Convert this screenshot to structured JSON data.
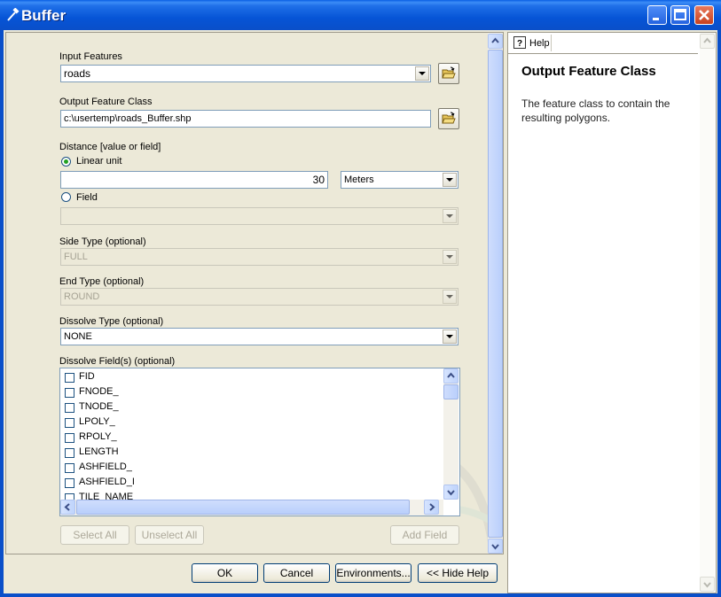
{
  "window": {
    "title": "Buffer"
  },
  "form": {
    "input_features": {
      "label": "Input Features",
      "value": "roads"
    },
    "output_feature_class": {
      "label": "Output Feature Class",
      "value": "c:\\usertemp\\roads_Buffer.shp"
    },
    "distance": {
      "label": "Distance [value or field]",
      "linear_unit_label": "Linear unit",
      "linear_unit_selected": true,
      "value": "30",
      "unit": "Meters",
      "field_label": "Field",
      "field_value": ""
    },
    "side_type": {
      "label": "Side Type (optional)",
      "value": "FULL"
    },
    "end_type": {
      "label": "End Type (optional)",
      "value": "ROUND"
    },
    "dissolve_type": {
      "label": "Dissolve Type (optional)",
      "value": "NONE"
    },
    "dissolve_fields": {
      "label": "Dissolve Field(s) (optional)",
      "items": [
        "FID",
        "FNODE_",
        "TNODE_",
        "LPOLY_",
        "RPOLY_",
        "LENGTH",
        "ASHFIELD_",
        "ASHFIELD_I",
        "TILE_NAME"
      ]
    },
    "select_all_label": "Select All",
    "unselect_all_label": "Unselect All",
    "add_field_label": "Add Field"
  },
  "footer": {
    "ok": "OK",
    "cancel": "Cancel",
    "environments": "Environments...",
    "hide_help": "<< Hide Help"
  },
  "help": {
    "tab_label": "Help",
    "title": "Output Feature Class",
    "body": "The feature class to contain the resulting polygons."
  },
  "colors": {
    "titlebar": "#0a5fe4",
    "dialog_bg": "#ece9d8",
    "field_border": "#7f9db9"
  }
}
